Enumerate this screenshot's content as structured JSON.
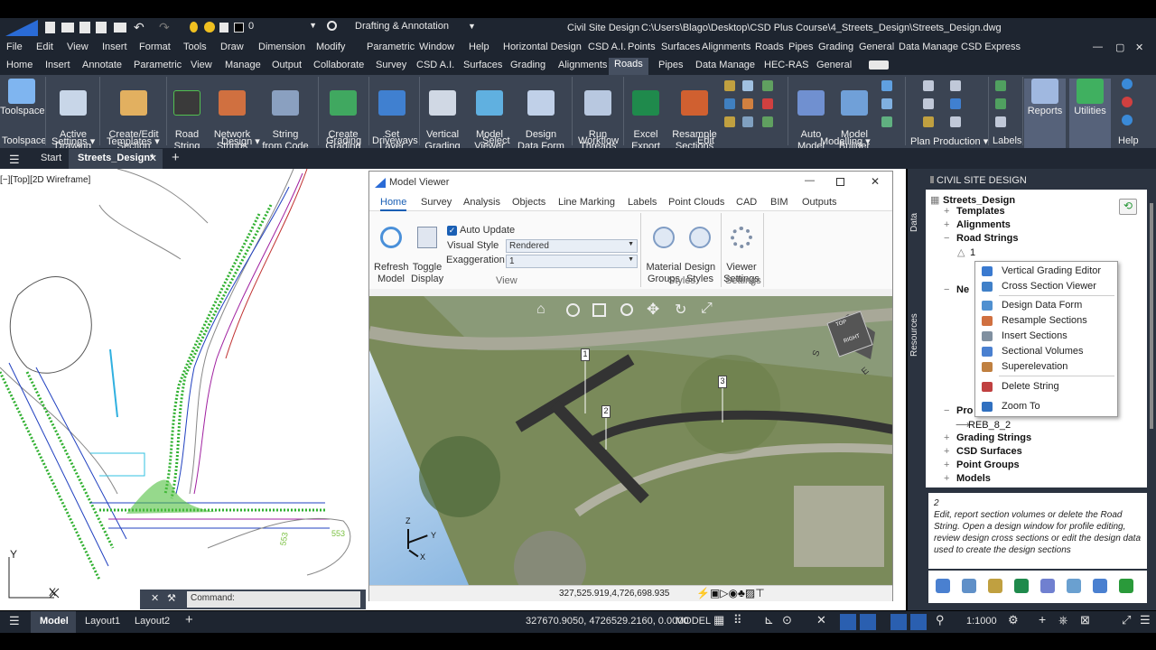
{
  "title_bar": {
    "workspace": "Drafting & Annotation",
    "layer_value": "0",
    "app_name": "Civil Site Design",
    "file_path": "C:\\Users\\Blago\\Desktop\\CSD Plus Course\\4_Streets_Design\\Streets_Design.dwg"
  },
  "menu": [
    "File",
    "Edit",
    "View",
    "Insert",
    "Format",
    "Tools",
    "Draw",
    "Dimension",
    "Modify",
    "Parametric",
    "Window",
    "Help",
    "Horizontal Design",
    "CSD A.I.",
    "Points",
    "Surfaces",
    "Alignments",
    "Roads",
    "Pipes",
    "Grading",
    "General",
    "Data Manage",
    "CSD Express"
  ],
  "ribbon_tabs": [
    "Home",
    "Insert",
    "Annotate",
    "Parametric",
    "View",
    "Manage",
    "Output",
    "Collaborate",
    "Survey",
    "CSD A.I.",
    "Surfaces",
    "Grading",
    "Alignments",
    "Roads",
    "Pipes",
    "Data Manage",
    "HEC-RAS",
    "General"
  ],
  "ribbon": {
    "buttons": {
      "toolspace": "Toolspace",
      "active_drawing": "Active\nDrawing",
      "create_edit_section": "Create/Edit\nSection",
      "road_string": "Road\nString",
      "network_strings": "Network\nStrings",
      "string_from_code": "String\nfrom Code",
      "create_grading": "Create\nGrading",
      "set_layer": "Set\nLayer",
      "vertical_grading": "Vertical\nGrading",
      "model_viewer": "Model\nViewer",
      "design_data_form": "Design\nData Form",
      "run_threads": "Run\nThreads",
      "excel_export": "Excel\nExport",
      "resample_sections": "Resample\nSections",
      "auto_model": "Auto\nModel",
      "model_builder": "Model\nBuilder",
      "reports": "Reports",
      "utilities": "Utilities",
      "help": "Help"
    },
    "groups": {
      "toolspace": "Toolspace",
      "settings": "Settings",
      "templates": "Templates",
      "design": "Design",
      "grading": "Grading",
      "driveways": "Driveways",
      "select": "Select",
      "workflow": "Workflow",
      "edit": "Edit",
      "modelling": "Modelling",
      "plan_production": "Plan Production",
      "labels": "Labels"
    }
  },
  "doc_tabs": {
    "start": "Start",
    "active": "Streets_Design*"
  },
  "viewport_label": "[−][Top][2D Wireframe]",
  "command_placeholder": "Command:",
  "drawing_labels": {
    "l553a": "553",
    "l553b": "553",
    "y": "Y",
    "x": "X"
  },
  "model_viewer": {
    "title": "Model Viewer",
    "tabs": [
      "Home",
      "Survey",
      "Analysis",
      "Objects",
      "Line Marking",
      "Labels",
      "Point Clouds",
      "CAD",
      "BIM",
      "Outputs"
    ],
    "refresh_model": "Refresh\nModel",
    "toggle_display": "Toggle\nDisplay",
    "auto_update": "Auto Update",
    "visual_style_label": "Visual Style",
    "visual_style_value": "Rendered",
    "exaggeration_label": "Exaggeration",
    "exaggeration_value": "1",
    "material_groups": "Material\nGroups",
    "design_styles": "Design\nStyles",
    "viewer_settings": "Viewer\nSettings",
    "group_view": "View",
    "group_styles": "Styles",
    "group_settings": "Settings",
    "markers": [
      "1",
      "2",
      "3"
    ],
    "axis": {
      "z": "Z",
      "y": "Y",
      "x": "X"
    },
    "cube": {
      "top": "TOP",
      "right": "RIGHT",
      "s": "S",
      "e": "E"
    },
    "coords": "327,525.919,4,726,698.935"
  },
  "right_panel": {
    "header": "CIVIL SITE DESIGN",
    "side_tabs": [
      "Data",
      "Resources"
    ],
    "tree": {
      "root": "Streets_Design",
      "templates": "Templates",
      "alignments": "Alignments",
      "road_strings": "Road Strings",
      "rs1": "1",
      "ne": "Ne",
      "pro": "Pro",
      "reb": "REB_8_2",
      "grading_strings": "Grading Strings",
      "csd_surfaces": "CSD Surfaces",
      "point_groups": "Point Groups",
      "models": "Models"
    },
    "context_menu": [
      "Vertical Grading Editor",
      "Cross Section Viewer",
      "Design Data Form",
      "Resample Sections",
      "Insert Sections",
      "Sectional Volumes",
      "Superelevation",
      "Delete String",
      "Zoom To"
    ],
    "desc_title": "2",
    "desc_text": "Edit, report section volumes or delete the Road String. Open a design window for profile editing, review design cross sections or edit the design data used to create the design sections"
  },
  "status": {
    "model_tab": "Model",
    "layout1": "Layout1",
    "layout2": "Layout2",
    "coords": "327670.9050, 4726529.2160, 0.0000",
    "model": "MODEL",
    "scale": "1:1000"
  }
}
